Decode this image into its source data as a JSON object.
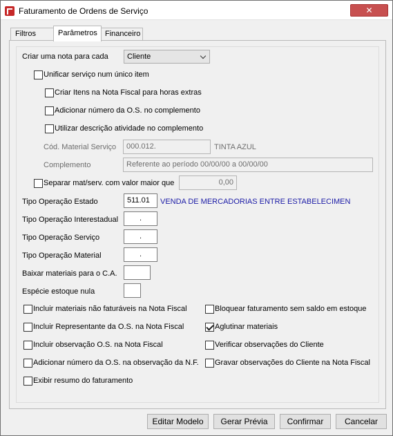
{
  "window": {
    "title": "Faturamento de Ordens de Serviço",
    "close_label": "✕"
  },
  "tabs": [
    {
      "label": "Filtros"
    },
    {
      "label": "Parâmetros"
    },
    {
      "label": "Financeiro"
    }
  ],
  "form": {
    "criar_nota_label": "Criar uma nota para cada",
    "criar_nota_value": "Cliente",
    "unificar_label": "Unificar serviço num único item",
    "criar_itens_label": "Criar Itens na Nota Fiscal para horas extras",
    "adicionar_os_label": "Adicionar número da O.S. no complemento",
    "utilizar_desc_label": "Utilizar descrição atividade no complemento",
    "cod_material_label": "Cód. Material Serviço",
    "cod_material_value": "000.012.",
    "cod_material_desc": "TINTA AZUL",
    "complemento_label": "Complemento",
    "complemento_value": "Referente ao período 00/00/00 a 00/00/00",
    "separar_label": "Separar mat/serv. com valor maior que",
    "separar_value": "0,00",
    "tipo_estado_label": "Tipo Operação Estado",
    "tipo_estado_value": "511.01",
    "tipo_estado_desc": "VENDA DE MERCADORIAS ENTRE ESTABELECIMEN",
    "tipo_interestadual_label": "Tipo Operação Interestadual",
    "tipo_interestadual_value": ".",
    "tipo_servico_label": "Tipo Operação Serviço",
    "tipo_servico_value": ".",
    "tipo_material_label": "Tipo Operação Material",
    "tipo_material_value": ".",
    "baixar_label": "Baixar materiais para o C.A.",
    "baixar_value": "",
    "especie_label": "Espécie estoque nula",
    "especie_value": ""
  },
  "options_left": [
    {
      "label": "Incluir materiais não faturáveis na Nota Fiscal",
      "checked": false
    },
    {
      "label": "Incluir Representante da O.S. na Nota Fiscal",
      "checked": false
    },
    {
      "label": "Incluir observação O.S. na Nota Fiscal",
      "checked": false
    },
    {
      "label": "Adicionar número da O.S. na observação da N.F.",
      "checked": false
    },
    {
      "label": "Exibir resumo do faturamento",
      "checked": false
    }
  ],
  "options_right": [
    {
      "label": "Bloquear faturamento sem saldo em estoque",
      "checked": false
    },
    {
      "label": "Aglutinar materiais",
      "checked": true
    },
    {
      "label": "Verificar observações do Cliente",
      "checked": false
    },
    {
      "label": "Gravar observações do Cliente na Nota Fiscal",
      "checked": false
    }
  ],
  "buttons": {
    "editar": "Editar Modelo",
    "gerar": "Gerar Prévia",
    "confirmar": "Confirmar",
    "cancelar": "Cancelar"
  }
}
